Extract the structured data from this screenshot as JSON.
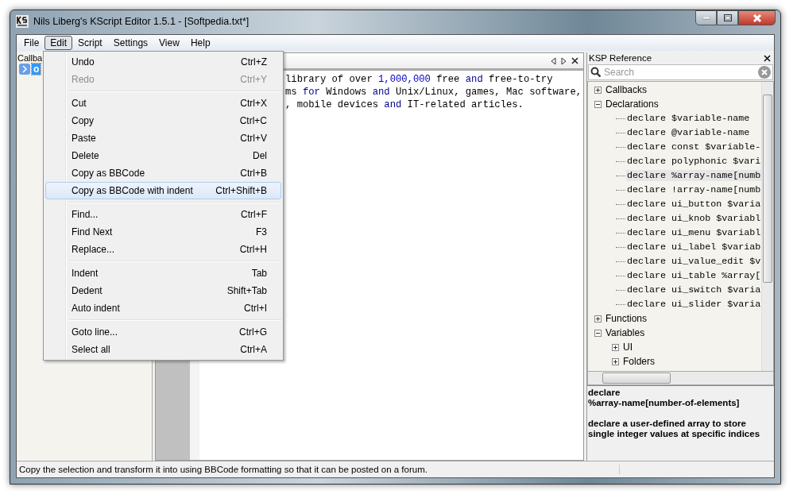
{
  "window": {
    "title": "Nils Liberg's KScript Editor 1.5.1 - [Softpedia.txt*]"
  },
  "menubar": [
    {
      "label": "File",
      "selected": false
    },
    {
      "label": "Edit",
      "selected": true
    },
    {
      "label": "Script",
      "selected": false
    },
    {
      "label": "Settings",
      "selected": false
    },
    {
      "label": "View",
      "selected": false
    },
    {
      "label": "Help",
      "selected": false
    }
  ],
  "callbacks_panel": {
    "title": "Callba",
    "items": [
      {
        "label": "o",
        "selected": true
      }
    ]
  },
  "edit_menu": [
    {
      "kind": "item",
      "label": "Undo",
      "shortcut": "Ctrl+Z",
      "disabled": false,
      "selected": false
    },
    {
      "kind": "item",
      "label": "Redo",
      "shortcut": "Ctrl+Y",
      "disabled": true,
      "selected": false
    },
    {
      "kind": "separator"
    },
    {
      "kind": "item",
      "label": "Cut",
      "shortcut": "Ctrl+X",
      "disabled": false,
      "selected": false
    },
    {
      "kind": "item",
      "label": "Copy",
      "shortcut": "Ctrl+C",
      "disabled": false,
      "selected": false
    },
    {
      "kind": "item",
      "label": "Paste",
      "shortcut": "Ctrl+V",
      "disabled": false,
      "selected": false
    },
    {
      "kind": "item",
      "label": "Delete",
      "shortcut": "Del",
      "disabled": false,
      "selected": false
    },
    {
      "kind": "item",
      "label": "Copy as BBCode",
      "shortcut": "Ctrl+B",
      "disabled": false,
      "selected": false
    },
    {
      "kind": "item",
      "label": "Copy as BBCode with indent",
      "shortcut": "Ctrl+Shift+B",
      "disabled": false,
      "selected": true
    },
    {
      "kind": "separator"
    },
    {
      "kind": "item",
      "label": "Find...",
      "shortcut": "Ctrl+F",
      "disabled": false,
      "selected": false
    },
    {
      "kind": "item",
      "label": "Find Next",
      "shortcut": "F3",
      "disabled": false,
      "selected": false
    },
    {
      "kind": "item",
      "label": "Replace...",
      "shortcut": "Ctrl+H",
      "disabled": false,
      "selected": false
    },
    {
      "kind": "separator"
    },
    {
      "kind": "item",
      "label": "Indent",
      "shortcut": "Tab",
      "disabled": false,
      "selected": false
    },
    {
      "kind": "item",
      "label": "Dedent",
      "shortcut": "Shift+Tab",
      "disabled": false,
      "selected": false
    },
    {
      "kind": "item",
      "label": "Auto indent",
      "shortcut": "Ctrl+I",
      "disabled": false,
      "selected": false
    },
    {
      "kind": "separator"
    },
    {
      "kind": "item",
      "label": "Goto line...",
      "shortcut": "Ctrl+G",
      "disabled": false,
      "selected": false
    },
    {
      "kind": "item",
      "label": "Select all",
      "shortcut": "Ctrl+A",
      "disabled": false,
      "selected": false
    }
  ],
  "editor": {
    "lines": [
      [
        {
          "kind": "plain",
          "text": "library of over "
        },
        {
          "kind": "number",
          "text": "1,000,000"
        },
        {
          "kind": "plain",
          "text": " free "
        },
        {
          "kind": "keyword",
          "text": "and"
        },
        {
          "kind": "plain",
          "text": " free-to-try"
        }
      ],
      [
        {
          "kind": "plain",
          "text": "ms "
        },
        {
          "kind": "keyword",
          "text": "for"
        },
        {
          "kind": "plain",
          "text": " Windows "
        },
        {
          "kind": "keyword",
          "text": "and"
        },
        {
          "kind": "plain",
          "text": " Unix/Linux, games, Mac software,"
        }
      ],
      [
        {
          "kind": "plain",
          "text": ", mobile devices "
        },
        {
          "kind": "keyword",
          "text": "and"
        },
        {
          "kind": "plain",
          "text": " IT-related articles."
        }
      ]
    ]
  },
  "ksp_reference": {
    "title": "KSP Reference",
    "search": {
      "placeholder": "Search"
    },
    "tree": [
      {
        "label": "Callbacks",
        "expanded": false,
        "selected": false
      },
      {
        "label": "Declarations",
        "expanded": true,
        "selected": false,
        "children": [
          {
            "label": "declare $variable-name",
            "selected": false
          },
          {
            "label": "declare @variable-name",
            "selected": false
          },
          {
            "label": "declare const $variable-",
            "selected": false
          },
          {
            "label": "declare polyphonic $vari",
            "selected": false
          },
          {
            "label": "declare %array-name[numb",
            "selected": true
          },
          {
            "label": "declare !array-name[numb",
            "selected": false
          },
          {
            "label": "declare ui_button $varia",
            "selected": false
          },
          {
            "label": "declare ui_knob $variabl",
            "selected": false
          },
          {
            "label": "declare ui_menu $variabl",
            "selected": false
          },
          {
            "label": "declare ui_label $variab",
            "selected": false
          },
          {
            "label": "declare ui_value_edit $v",
            "selected": false
          },
          {
            "label": "declare ui_table %array[",
            "selected": false
          },
          {
            "label": "declare ui_switch $varia",
            "selected": false
          },
          {
            "label": "declare ui_slider $varia",
            "selected": false
          }
        ]
      },
      {
        "label": "Functions",
        "expanded": false,
        "selected": false
      },
      {
        "label": "Variables",
        "expanded": true,
        "selected": false,
        "children": [
          {
            "label": "UI",
            "expanded": false,
            "selected": false
          },
          {
            "label": "Folders",
            "expanded": false,
            "selected": false
          }
        ]
      }
    ],
    "description": {
      "signature": "declare\n%array-name[number-of-elements]",
      "text": "declare a user-defined array to store single integer values at specific indices"
    }
  },
  "status_bar": {
    "text": "Copy the selection and transform it into using BBCode formatting so that it can be posted on a forum."
  }
}
